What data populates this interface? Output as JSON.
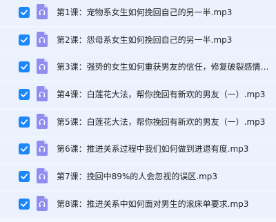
{
  "files": [
    {
      "name": "第1课：宠物系女生如何挽回自己的另一半.mp3",
      "checked": true,
      "icon": "audio-file-icon"
    },
    {
      "name": "第2课：怨母系女生如何挽回自己的另一半.mp3",
      "checked": true,
      "icon": "audio-file-icon"
    },
    {
      "name": "第3课：强势的女生如何重获男友的信任，修复破裂感情....",
      "checked": true,
      "icon": "audio-file-icon"
    },
    {
      "name": "第4课：白莲花大法，帮你挽回有新欢的男友（一）.mp3",
      "checked": true,
      "icon": "audio-file-icon"
    },
    {
      "name": "第5课：白莲花大法，帮你挽回有新欢的男友（一）.mp3",
      "checked": true,
      "icon": "audio-file-icon"
    },
    {
      "name": "第6课：推进关系过程中我们如何做到进退有度.mp3",
      "checked": true,
      "icon": "audio-file-icon"
    },
    {
      "name": "第7课：挽回中89%的人会忽视的误区.mp3",
      "checked": true,
      "icon": "audio-file-icon"
    },
    {
      "name": "第8课：推进关系中如何面对男生的滚床单要求.mp3",
      "checked": true,
      "icon": "audio-file-icon"
    }
  ],
  "colors": {
    "checkbox": "#1b87fa",
    "icon": "#8f8ef0",
    "row_background": "#ebf2fe",
    "page_background": "#f2f7ff"
  }
}
